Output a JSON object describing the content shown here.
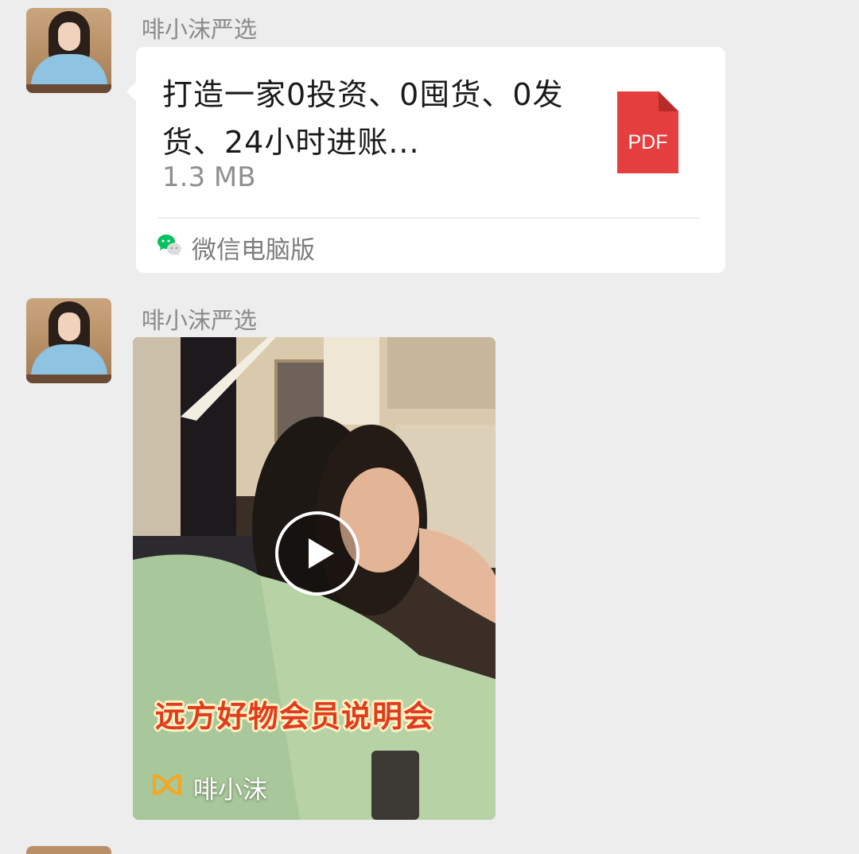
{
  "messages": [
    {
      "sender": "啡小沫严选",
      "type": "file",
      "file": {
        "name": "打造一家0投资、0囤货、0发货、24小时进账...",
        "size": "1.3 MB",
        "icon_label": "PDF",
        "icon_color": "#e53e3e",
        "source": "微信电脑版",
        "source_icon": "wechat-icon"
      }
    },
    {
      "sender": "啡小沫严选",
      "type": "video",
      "video": {
        "caption": "远方好物会员说明会",
        "channel_name": "啡小沫",
        "channel_icon": "channels-icon",
        "play_icon": "play-icon"
      }
    }
  ],
  "colors": {
    "background": "#ededed",
    "bubble": "#ffffff",
    "sender_text": "#8a8a8a",
    "caption_red": "#e13b1d",
    "wechat_green": "#07c160"
  }
}
